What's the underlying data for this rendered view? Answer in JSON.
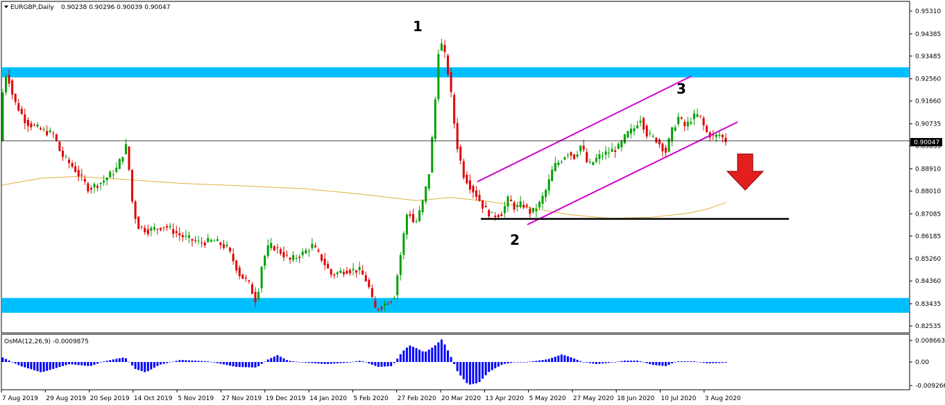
{
  "chart_data": {
    "type": "candlestick",
    "header": {
      "symbol": "EURGBP,Daily",
      "ohlc": "0.90238 0.90296 0.90039 0.90047"
    },
    "price_axis": {
      "ticks": [
        "0.95310",
        "0.94385",
        "0.93485",
        "0.92560",
        "0.91660",
        "0.90735",
        "0.89835",
        "0.88910",
        "0.88010",
        "0.87085",
        "0.86185",
        "0.85260",
        "0.84360",
        "0.83435",
        "0.82535"
      ],
      "current_price_label": "0.90047",
      "current_price": 0.90047
    },
    "time_axis": {
      "labels": [
        "7 Aug 2019",
        "29 Aug 2019",
        "20 Sep 2019",
        "14 Oct 2019",
        "5 Nov 2019",
        "27 Nov 2019",
        "19 Dec 2019",
        "14 Jan 2020",
        "5 Feb 2020",
        "27 Feb 2020",
        "20 Mar 2020",
        "13 Apr 2020",
        "5 May 2020",
        "27 May 2020",
        "18 Jun 2020",
        "10 Jul 2020",
        "3 Aug 2020"
      ]
    },
    "zones": [
      {
        "name": "resistance-zone",
        "from": 0.9262,
        "to": 0.9303,
        "color": "#00bfff"
      },
      {
        "name": "support-zone",
        "from": 0.8307,
        "to": 0.8367,
        "color": "#00bfff"
      }
    ],
    "swing_labels": [
      "1",
      "2",
      "3"
    ],
    "support_line_level": 0.8688,
    "colors": {
      "bull": "#00a000",
      "bear": "#e00000",
      "moving_average": "#e0b040",
      "channel": "#d000d0",
      "arrow": "#e31e1e"
    },
    "oscillator": {
      "title": "OsMA(12,26,9) -0.0009875",
      "ticks": [
        "0.0086635",
        "0.00",
        "-0.009266"
      ],
      "color": "#0000ff"
    }
  }
}
